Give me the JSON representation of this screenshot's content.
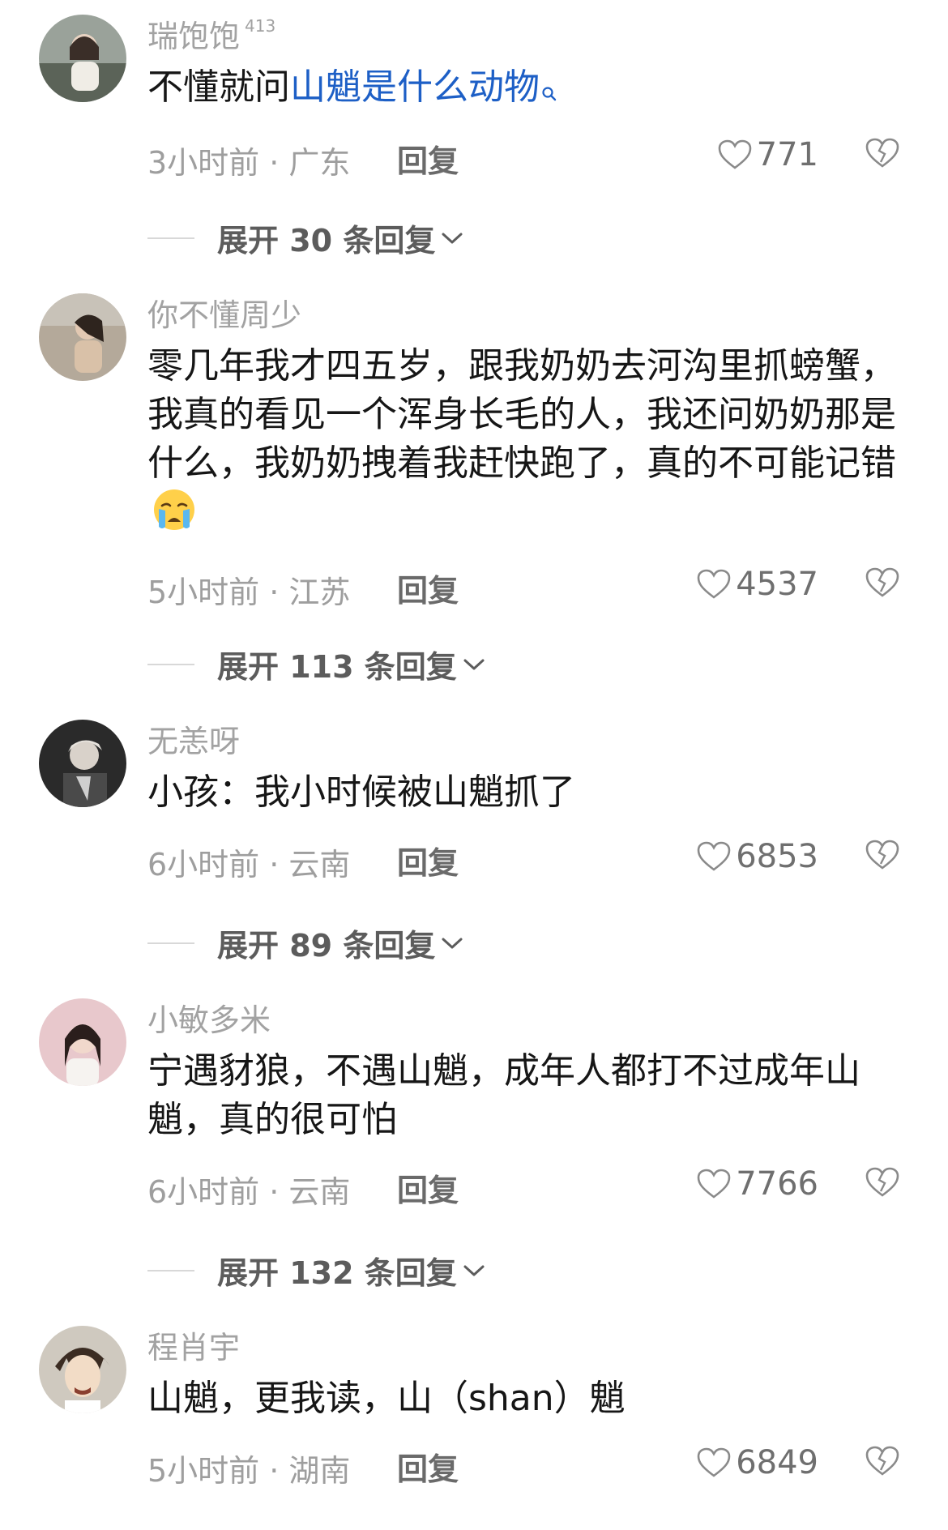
{
  "comments": [
    {
      "username": "瑞饱饱",
      "badge": "413",
      "text_plain": "不懂就问",
      "text_link": "山魈是什么动物",
      "time_location": "3小时前 · 广东",
      "reply_label": "回复",
      "likes": "771",
      "expand_label": "展开 30 条回复"
    },
    {
      "username": "你不懂周少",
      "text": "零几年我才四五岁，跟我奶奶去河沟里抓螃蟹，我真的看见一个浑身长毛的人，我还问奶奶那是什么，我奶奶拽着我赶快跑了，真的不可能记错",
      "emoji": "crying-face",
      "time_location": "5小时前 · 江苏",
      "reply_label": "回复",
      "likes": "4537",
      "expand_label": "展开 113 条回复"
    },
    {
      "username": "无恙呀",
      "text": "小孩：我小时候被山魈抓了",
      "time_location": "6小时前 · 云南",
      "reply_label": "回复",
      "likes": "6853",
      "expand_label": "展开 89 条回复"
    },
    {
      "username": "小敏多米",
      "text": "宁遇豺狼，不遇山魈，成年人都打不过成年山魈，真的很可怕",
      "time_location": "6小时前 · 云南",
      "reply_label": "回复",
      "likes": "7766",
      "expand_label": "展开 132 条回复"
    },
    {
      "username": "程肖宇",
      "text": "山魈，更我读，山（shan）魈",
      "time_location": "5小时前 · 湖南",
      "reply_label": "回复",
      "likes": "6849"
    }
  ],
  "colors": {
    "link": "#1d5fc6",
    "username": "#a2a2a2",
    "text": "#161616",
    "meta": "#9e9e9e"
  },
  "icons": {
    "like": "heart-outline-icon",
    "dislike": "broken-heart-icon",
    "expand": "chevron-down-icon",
    "search": "search-icon"
  }
}
